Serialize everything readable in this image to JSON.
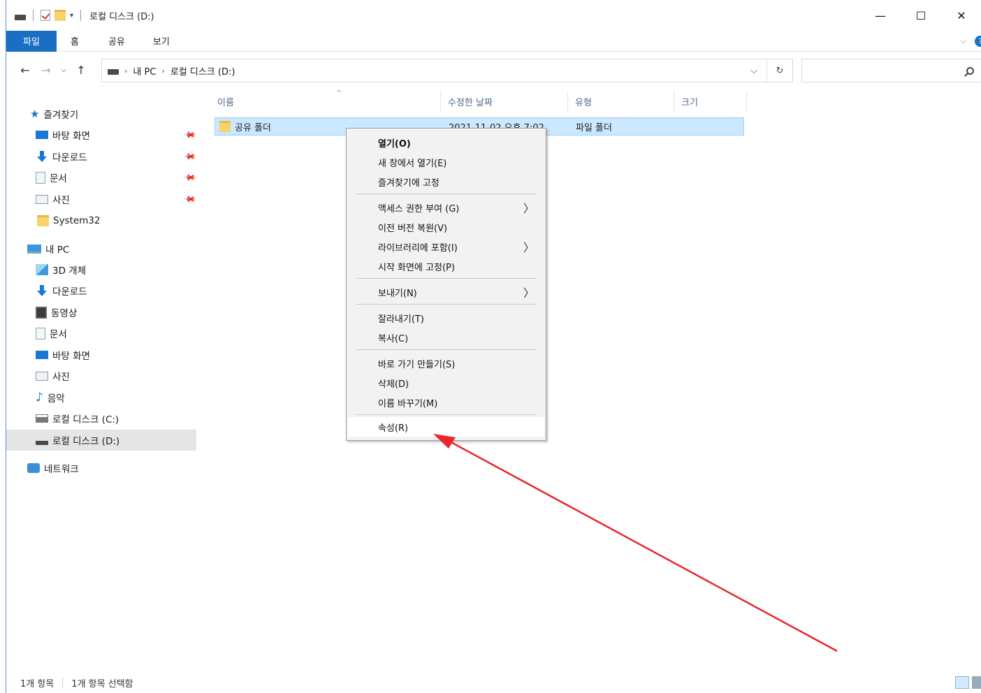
{
  "title_bar": {
    "title": "로컬 디스크 (D:)",
    "quick_access_dropdown": "▾",
    "minimize": "—",
    "maximize": "☐",
    "close": "✕"
  },
  "ribbon": {
    "tabs": [
      "파일",
      "홈",
      "공유",
      "보기"
    ],
    "expand": "⌵",
    "help": "?"
  },
  "address": {
    "back": "←",
    "forward": "→",
    "recent": "⌵",
    "up": "↑",
    "sep": "›",
    "crumbs": [
      "내 PC",
      "로컬 디스크 (D:)"
    ],
    "dropdown": "⌵",
    "refresh": "↻",
    "search_placeholder": ""
  },
  "sidebar": {
    "quick_access": "즐겨찾기",
    "pinned": [
      {
        "label": "바탕 화면",
        "icon": "desktop-icon"
      },
      {
        "label": "다운로드",
        "icon": "download-icon"
      },
      {
        "label": "문서",
        "icon": "document-icon"
      },
      {
        "label": "사진",
        "icon": "picture-icon"
      }
    ],
    "pin_glyph": "📌",
    "system32": "System32",
    "this_pc": "내 PC",
    "pc_items": [
      "3D 개체",
      "다운로드",
      "동영상",
      "문서",
      "바탕 화면",
      "사진",
      "음악",
      "로컬 디스크 (C:)",
      "로컬 디스크 (D:)"
    ],
    "network": "네트워크"
  },
  "columns": {
    "name": "이름",
    "date": "수정한 날짜",
    "type": "유형",
    "size": "크기",
    "sort_glyph": "^"
  },
  "files": [
    {
      "name": "공유 폴더",
      "date": "2021-11-02 오후 7:02",
      "type": "파일 폴더",
      "size": ""
    }
  ],
  "context_menu": {
    "group1": [
      "열기(O)",
      "새 창에서 열기(E)",
      "즐겨찾기에 고정"
    ],
    "group2": [
      "액세스 권한 부여 (G)",
      "이전 버전 복원(V)",
      "라이브러리에 포함(I)",
      "시작 화면에 고정(P)"
    ],
    "group3": [
      "보내기(N)"
    ],
    "group4": [
      "잘라내기(T)",
      "복사(C)"
    ],
    "group5": [
      "바로 가기 만들기(S)",
      "삭제(D)",
      "이름 바꾸기(M)"
    ],
    "group6": [
      "속성(R)"
    ],
    "submenu_arrow": "〉"
  },
  "status_bar": {
    "item_count": "1개 항목",
    "selected": "1개 항목 선택함"
  },
  "annotation": {
    "arrow_color": "#e8262b"
  }
}
